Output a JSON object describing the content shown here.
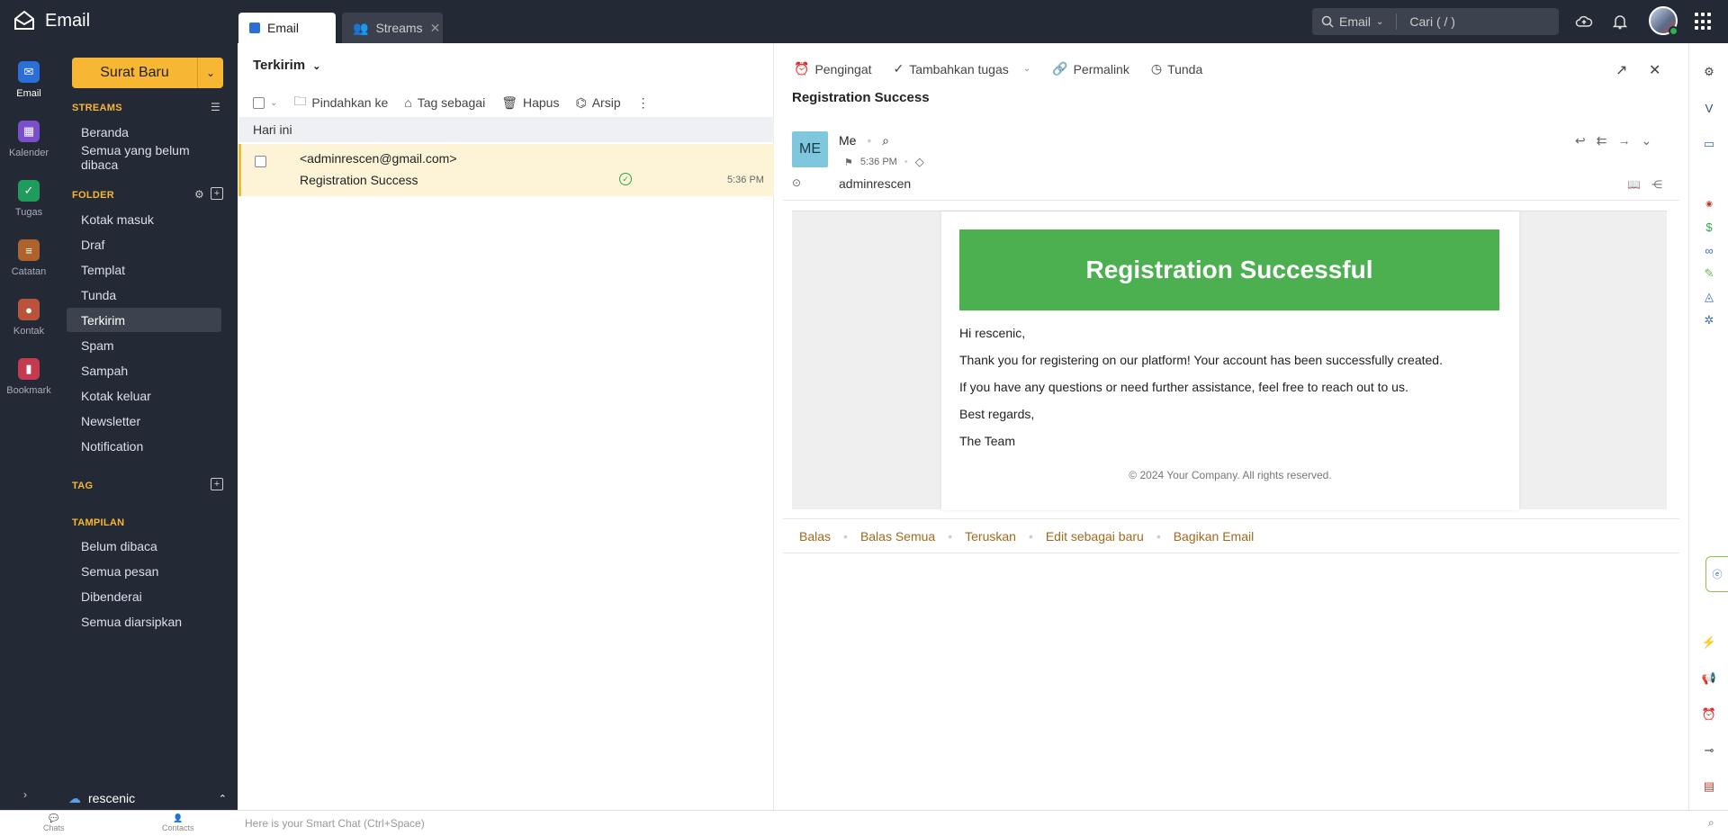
{
  "app": {
    "title": "Email"
  },
  "tabs": [
    {
      "label": "Email"
    },
    {
      "label": "Streams"
    }
  ],
  "search": {
    "scope": "Email",
    "placeholder": "Cari ( / )"
  },
  "left_rail": [
    {
      "label": "Email",
      "color": "#2b6fd6"
    },
    {
      "label": "Kalender",
      "color": "#7b4fc9"
    },
    {
      "label": "Tugas",
      "color": "#1f9b5b"
    },
    {
      "label": "Catatan",
      "color": "#b0622c"
    },
    {
      "label": "Kontak",
      "color": "#b8543c"
    },
    {
      "label": "Bookmark",
      "color": "#c43a4e"
    }
  ],
  "sidebar": {
    "compose_label": "Surat Baru",
    "streams_title": "STREAMS",
    "streams": [
      "Beranda",
      "Semua yang belum dibaca"
    ],
    "folder_title": "FOLDER",
    "folders": [
      "Kotak masuk",
      "Draf",
      "Templat",
      "Tunda",
      "Terkirim",
      "Spam",
      "Sampah",
      "Kotak keluar",
      "Newsletter",
      "Notification"
    ],
    "active_folder": "Terkirim",
    "tag_title": "TAG",
    "view_title": "TAMPILAN",
    "views": [
      "Belum dibaca",
      "Semua pesan",
      "Dibenderai",
      "Semua diarsipkan"
    ],
    "user": "rescenic"
  },
  "list": {
    "folder_name": "Terkirim",
    "toolbar": {
      "move": "Pindahkan ke",
      "tag": "Tag sebagai",
      "delete": "Hapus",
      "archive": "Arsip"
    },
    "group_label": "Hari ini",
    "messages": [
      {
        "from": "<adminrescen@gmail.com>",
        "subject": "Registration Success",
        "time": "5:36 PM"
      }
    ]
  },
  "reader": {
    "toolbar": {
      "reminder": "Pengingat",
      "add_task": "Tambahkan tugas",
      "permalink": "Permalink",
      "snooze": "Tunda"
    },
    "subject": "Registration Success",
    "sender_initials": "ME",
    "sender_name": "Me",
    "time": "5:36 PM",
    "to": "adminrescen",
    "body": {
      "banner": "Registration Successful",
      "greeting": "Hi rescenic,",
      "line1": "Thank you for registering on our platform! Your account has been successfully created.",
      "line2": "If you have any questions or need further assistance, feel free to reach out to us.",
      "closing": "Best regards,",
      "signature": "The Team",
      "copyright": "© 2024 Your Company. All rights reserved."
    },
    "actions": [
      "Balas",
      "Balas Semua",
      "Teruskan",
      "Edit sebagai baru",
      "Bagikan Email"
    ]
  },
  "bottom": {
    "chats": "Chats",
    "contacts": "Contacts",
    "smart_chat": "Here is your Smart Chat (Ctrl+Space)"
  }
}
